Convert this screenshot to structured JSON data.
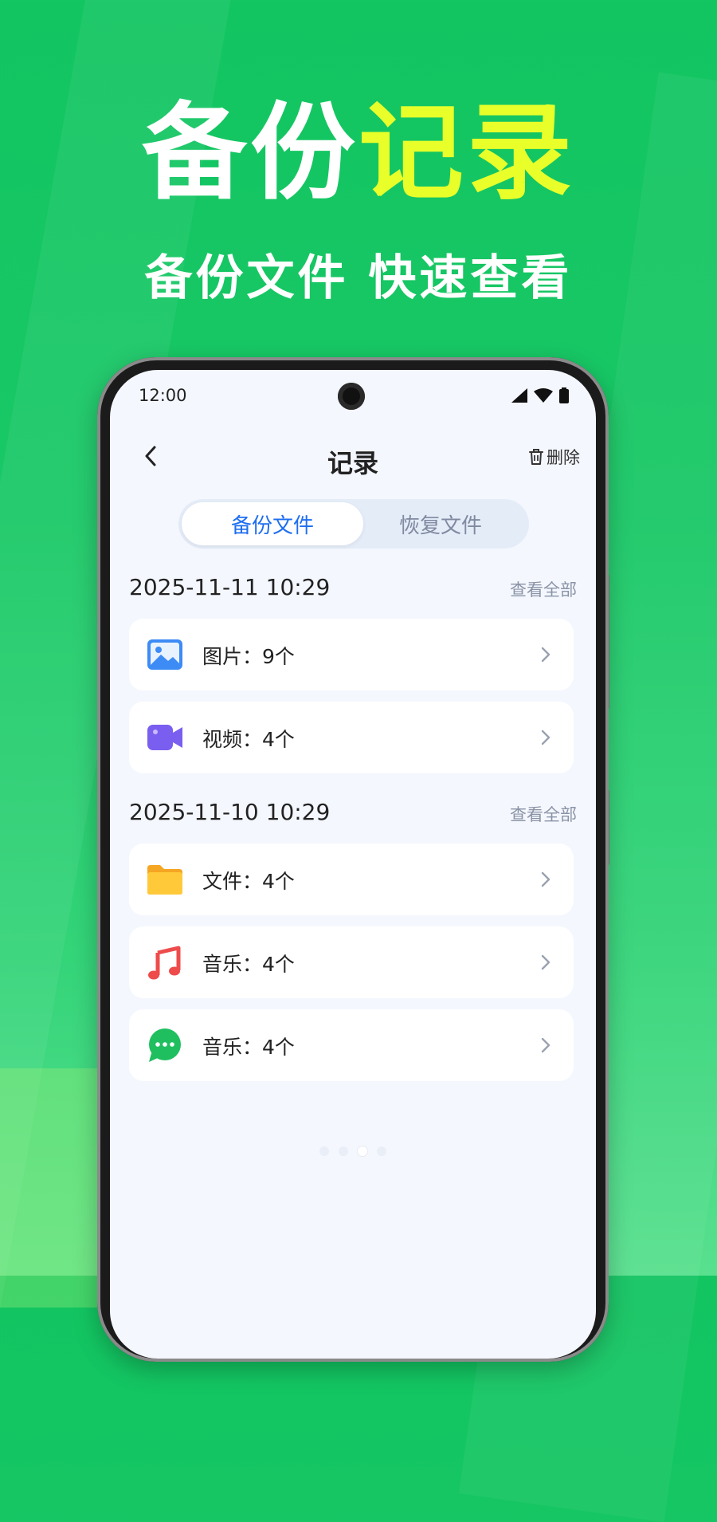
{
  "hero": {
    "title_part1": "备份",
    "title_part2": "记录",
    "subtitle": "备份文件 快速查看"
  },
  "status_bar": {
    "time": "12:00",
    "icons": [
      "signal-icon",
      "wifi-icon",
      "battery-icon"
    ]
  },
  "nav": {
    "back_icon": "chevron-left-icon",
    "title": "记录",
    "delete_icon": "trash-icon",
    "delete_label": "删除"
  },
  "tabs": [
    {
      "label": "备份文件",
      "active": true
    },
    {
      "label": "恢复文件",
      "active": false
    }
  ],
  "sections": [
    {
      "date": "2025-11-11 10:29",
      "link": "查看全部",
      "items": [
        {
          "icon": "image-icon",
          "label": "图片：9个"
        },
        {
          "icon": "video-icon",
          "label": "视频：4个"
        }
      ]
    },
    {
      "date": "2025-11-10 10:29",
      "link": "查看全部",
      "items": [
        {
          "icon": "folder-icon",
          "label": "文件：4个"
        },
        {
          "icon": "music-icon",
          "label": "音乐：4个"
        },
        {
          "icon": "message-icon",
          "label": "音乐：4个"
        }
      ]
    }
  ],
  "colors": {
    "background": "#19c866",
    "highlight": "#e9ff2a",
    "accent": "#1e6ef0",
    "screen_bg": "#f4f7fd"
  },
  "pager": {
    "count": 4,
    "active_index": 2
  }
}
